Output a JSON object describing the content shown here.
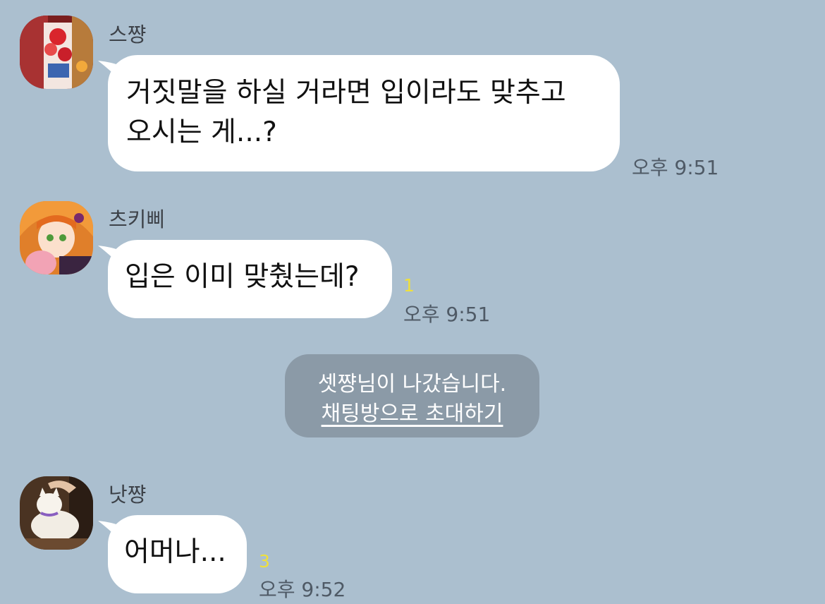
{
  "messages": [
    {
      "sender": "스쨩",
      "avatar": "strawberry-dessert-avatar",
      "lines": [
        "거짓말을 하실 거라면 입이라도 맞추고",
        "오시는 게...?"
      ],
      "unread": "",
      "time": "오후 9:51"
    },
    {
      "sender": "츠키삐",
      "avatar": "orange-hair-girl-avatar",
      "lines": [
        "입은 이미 맞췄는데?"
      ],
      "unread": "1",
      "time": "오후 9:51"
    },
    {
      "sender": "낫쨩",
      "avatar": "white-cat-avatar",
      "lines": [
        "어머나..."
      ],
      "unread": "3",
      "time": "오후 9:52"
    }
  ],
  "system_notice": {
    "text": "셋쨩님이 나갔습니다.",
    "link": "채팅방으로 초대하기"
  },
  "colors": {
    "background": "#abbfcf",
    "bubble": "#ffffff",
    "unread": "#f0e03a",
    "system_bubble": "#8b9aa7"
  }
}
